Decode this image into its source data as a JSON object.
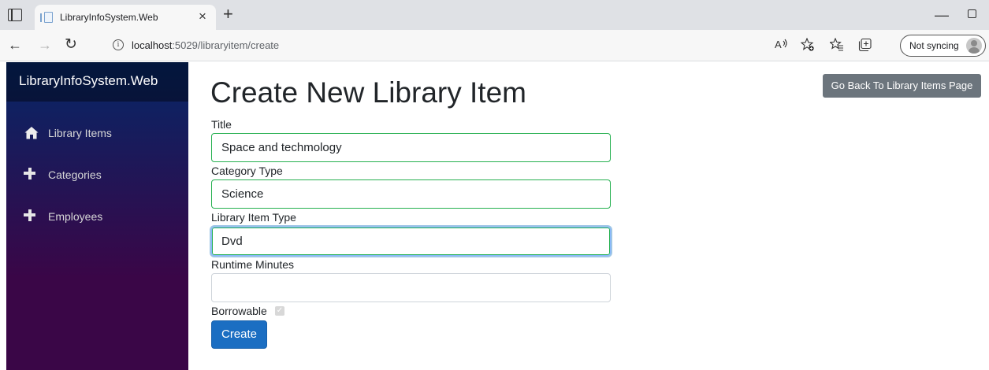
{
  "browser": {
    "tab_title": "LibraryInfoSystem.Web",
    "tab_close": "×",
    "new_tab": "+",
    "url_host": "localhost",
    "url_path": ":5029/libraryitem/create",
    "sync_label": "Not syncing"
  },
  "sidebar": {
    "brand": "LibraryInfoSystem.Web",
    "items": [
      {
        "label": "Library Items",
        "icon": "home-icon"
      },
      {
        "label": "Categories",
        "icon": "plus-icon"
      },
      {
        "label": "Employees",
        "icon": "plus-icon"
      }
    ]
  },
  "main": {
    "title": "Create New Library Item",
    "back_button": "Go Back To Library Items Page",
    "fields": [
      {
        "label": "Title",
        "value": "Space and techmology"
      },
      {
        "label": "Category Type",
        "value": "Science"
      },
      {
        "label": "Library Item Type",
        "value": "Dvd"
      },
      {
        "label": "Runtime Minutes",
        "value": ""
      }
    ],
    "borrowable_label": "Borrowable",
    "borrowable_checked": true,
    "create_button": "Create"
  },
  "colors": {
    "sidebar_top": "#052767",
    "sidebar_bottom": "#3a0647",
    "primary_button": "#1b6ec2",
    "secondary_button": "#6c757d",
    "valid_border": "#26b050"
  }
}
